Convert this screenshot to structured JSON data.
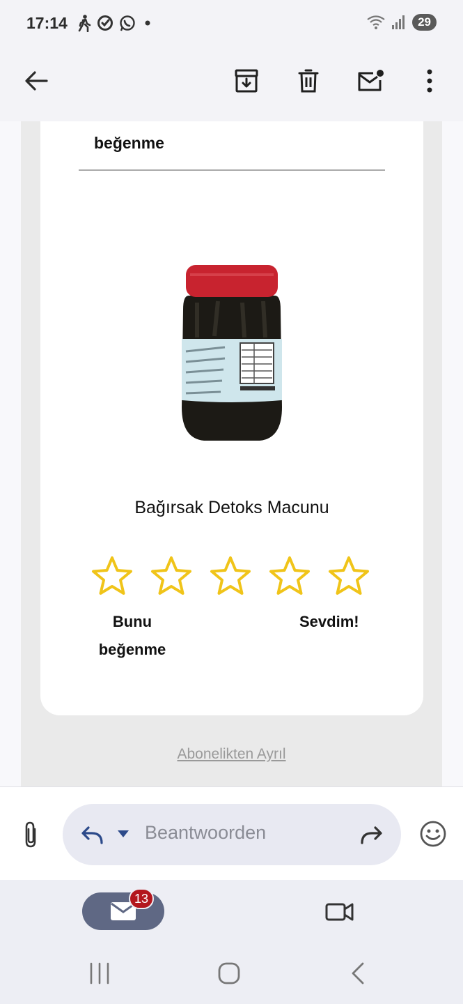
{
  "status_bar": {
    "time": "17:14",
    "battery": "29",
    "icons": [
      "walking-icon",
      "sync-icon",
      "whatsapp-icon",
      "dot-icon",
      "wifi-icon",
      "signal-icon"
    ]
  },
  "toolbar": {
    "icons": [
      "back-arrow-icon",
      "archive-icon",
      "delete-icon",
      "mark-unread-icon",
      "more-vert-icon"
    ]
  },
  "email": {
    "top_label": "beğenme",
    "product_title": "Bağırsak Detoks Macunu",
    "rating_low_label": "Bunu beğenme",
    "rating_high_label": "Sevdim!",
    "star_count": 5,
    "star_color": "#f0c419",
    "unsubscribe": "Abonelikten Ayrıl"
  },
  "reply_bar": {
    "placeholder": "Beantwoorden"
  },
  "bottom_nav": {
    "mail_badge": "13"
  },
  "colors": {
    "accent": "#5f6884",
    "badge": "#b3161d",
    "jar_lid": "#c8232f",
    "label_bg": "#cfe6ec"
  }
}
